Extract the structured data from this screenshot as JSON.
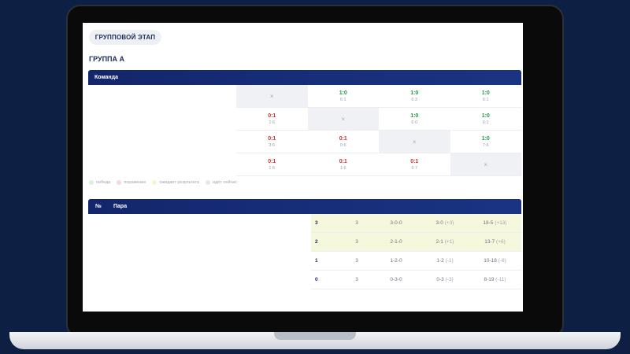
{
  "stage_tab": "ГРУППОВОЙ ЭТАП",
  "group_title": "ГРУППА А",
  "matrix_header": {
    "team": "Команда"
  },
  "matrix": {
    "self_symbol": "×",
    "rows": [
      [
        {
          "self": true
        },
        {
          "score": "1:0",
          "sub": "6:1",
          "result": "win"
        },
        {
          "score": "1:0",
          "sub": "6:3",
          "result": "win"
        },
        {
          "score": "1:0",
          "sub": "6:1",
          "result": "win"
        }
      ],
      [
        {
          "score": "0:1",
          "sub": "1:6",
          "result": "loss"
        },
        {
          "self": true
        },
        {
          "score": "1:0",
          "sub": "6:0",
          "result": "win"
        },
        {
          "score": "1:0",
          "sub": "6:1",
          "result": "win"
        }
      ],
      [
        {
          "score": "0:1",
          "sub": "3:6",
          "result": "loss"
        },
        {
          "score": "0:1",
          "sub": "0:6",
          "result": "loss"
        },
        {
          "self": true
        },
        {
          "score": "1:0",
          "sub": "7:6",
          "result": "win"
        }
      ],
      [
        {
          "score": "0:1",
          "sub": "1:6",
          "result": "loss"
        },
        {
          "score": "0:1",
          "sub": "1:6",
          "result": "loss"
        },
        {
          "score": "0:1",
          "sub": "6:7",
          "result": "loss"
        },
        {
          "self": true
        }
      ]
    ]
  },
  "legend": [
    {
      "label": "победа",
      "color": "#d9f2df"
    },
    {
      "label": "поражение",
      "color": "#f9d9d9"
    },
    {
      "label": "ожидает результата",
      "color": "#f4f6cf"
    },
    {
      "label": "идёт сейчас",
      "color": "#e6e8ec"
    }
  ],
  "standings_header": {
    "num": "№",
    "pair": "Пара"
  },
  "standings": [
    {
      "points": "3",
      "played": "3",
      "wdl": "3-0-0",
      "matches": "3-0",
      "matches_diff": "(+3)",
      "games": "18-5",
      "games_diff": "(+13)",
      "highlight": true
    },
    {
      "points": "2",
      "played": "3",
      "wdl": "2-1-0",
      "matches": "2-1",
      "matches_diff": "(+1)",
      "games": "13-7",
      "games_diff": "(+6)",
      "highlight": true
    },
    {
      "points": "1",
      "played": "3",
      "wdl": "1-2-0",
      "matches": "1-2",
      "matches_diff": "(-1)",
      "games": "10-18",
      "games_diff": "(-8)",
      "highlight": false
    },
    {
      "points": "0",
      "played": "3",
      "wdl": "0-3-0",
      "matches": "0-3",
      "matches_diff": "(-3)",
      "games": "8-19",
      "games_diff": "(-11)",
      "highlight": false
    }
  ]
}
